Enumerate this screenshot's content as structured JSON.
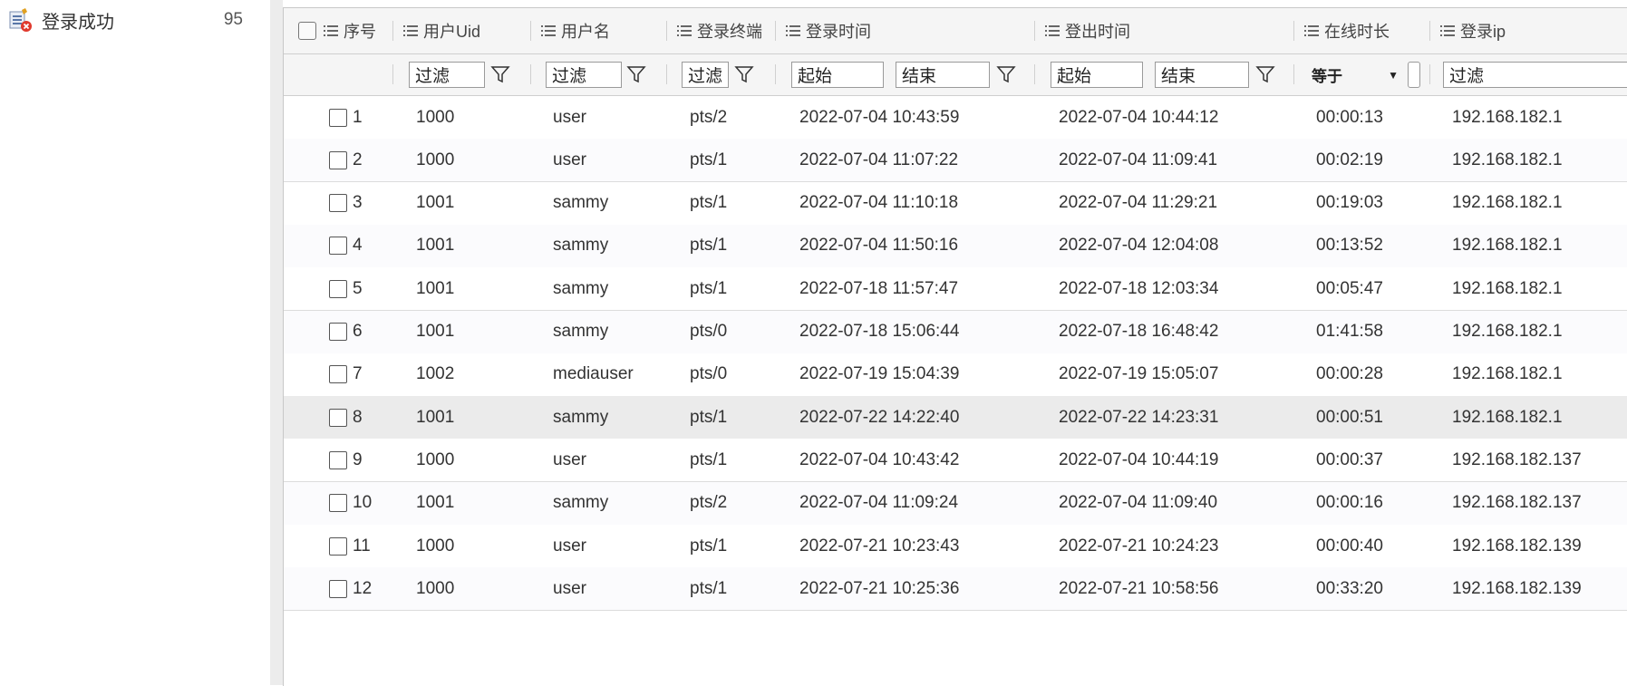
{
  "sidebar": {
    "item_label": "登录成功",
    "item_count": "95"
  },
  "columns": {
    "seq": "序号",
    "uid": "用户Uid",
    "username": "用户名",
    "terminal": "登录终端",
    "login_time": "登录时间",
    "logout_time": "登出时间",
    "online": "在线时长",
    "ip": "登录ip"
  },
  "filters": {
    "filter_text": "过滤",
    "start_text": "起始",
    "end_text": "结束",
    "equals_text": "等于"
  },
  "rows": [
    {
      "seq": "1",
      "uid": "1000",
      "username": "user",
      "terminal": "pts/2",
      "login": "2022-07-04 10:43:59",
      "logout": "2022-07-04 10:44:12",
      "online": "00:00:13",
      "ip": "192.168.182.1"
    },
    {
      "seq": "2",
      "uid": "1000",
      "username": "user",
      "terminal": "pts/1",
      "login": "2022-07-04 11:07:22",
      "logout": "2022-07-04 11:09:41",
      "online": "00:02:19",
      "ip": "192.168.182.1"
    },
    {
      "seq": "3",
      "uid": "1001",
      "username": "sammy",
      "terminal": "pts/1",
      "login": "2022-07-04 11:10:18",
      "logout": "2022-07-04 11:29:21",
      "online": "00:19:03",
      "ip": "192.168.182.1"
    },
    {
      "seq": "4",
      "uid": "1001",
      "username": "sammy",
      "terminal": "pts/1",
      "login": "2022-07-04 11:50:16",
      "logout": "2022-07-04 12:04:08",
      "online": "00:13:52",
      "ip": "192.168.182.1"
    },
    {
      "seq": "5",
      "uid": "1001",
      "username": "sammy",
      "terminal": "pts/1",
      "login": "2022-07-18 11:57:47",
      "logout": "2022-07-18 12:03:34",
      "online": "00:05:47",
      "ip": "192.168.182.1"
    },
    {
      "seq": "6",
      "uid": "1001",
      "username": "sammy",
      "terminal": "pts/0",
      "login": "2022-07-18 15:06:44",
      "logout": "2022-07-18 16:48:42",
      "online": "01:41:58",
      "ip": "192.168.182.1"
    },
    {
      "seq": "7",
      "uid": "1002",
      "username": "mediauser",
      "terminal": "pts/0",
      "login": "2022-07-19 15:04:39",
      "logout": "2022-07-19 15:05:07",
      "online": "00:00:28",
      "ip": "192.168.182.1"
    },
    {
      "seq": "8",
      "uid": "1001",
      "username": "sammy",
      "terminal": "pts/1",
      "login": "2022-07-22 14:22:40",
      "logout": "2022-07-22 14:23:31",
      "online": "00:00:51",
      "ip": "192.168.182.1"
    },
    {
      "seq": "9",
      "uid": "1000",
      "username": "user",
      "terminal": "pts/1",
      "login": "2022-07-04 10:43:42",
      "logout": "2022-07-04 10:44:19",
      "online": "00:00:37",
      "ip": "192.168.182.137"
    },
    {
      "seq": "10",
      "uid": "1001",
      "username": "sammy",
      "terminal": "pts/2",
      "login": "2022-07-04 11:09:24",
      "logout": "2022-07-04 11:09:40",
      "online": "00:00:16",
      "ip": "192.168.182.137"
    },
    {
      "seq": "11",
      "uid": "1000",
      "username": "user",
      "terminal": "pts/1",
      "login": "2022-07-21 10:23:43",
      "logout": "2022-07-21 10:24:23",
      "online": "00:00:40",
      "ip": "192.168.182.139"
    },
    {
      "seq": "12",
      "uid": "1000",
      "username": "user",
      "terminal": "pts/1",
      "login": "2022-07-21 10:25:36",
      "logout": "2022-07-21 10:58:56",
      "online": "00:33:20",
      "ip": "192.168.182.139"
    }
  ],
  "highlight_row": 7,
  "colors": {
    "header_bg": "#f5f5f5",
    "highlight_bg": "#ebebeb",
    "border": "#c8c8c8"
  },
  "icons": {
    "sidebar_item": "list-error-icon",
    "column_menu": "column-menu-icon",
    "filter": "funnel-icon",
    "dropdown": "triangle-down-icon"
  }
}
